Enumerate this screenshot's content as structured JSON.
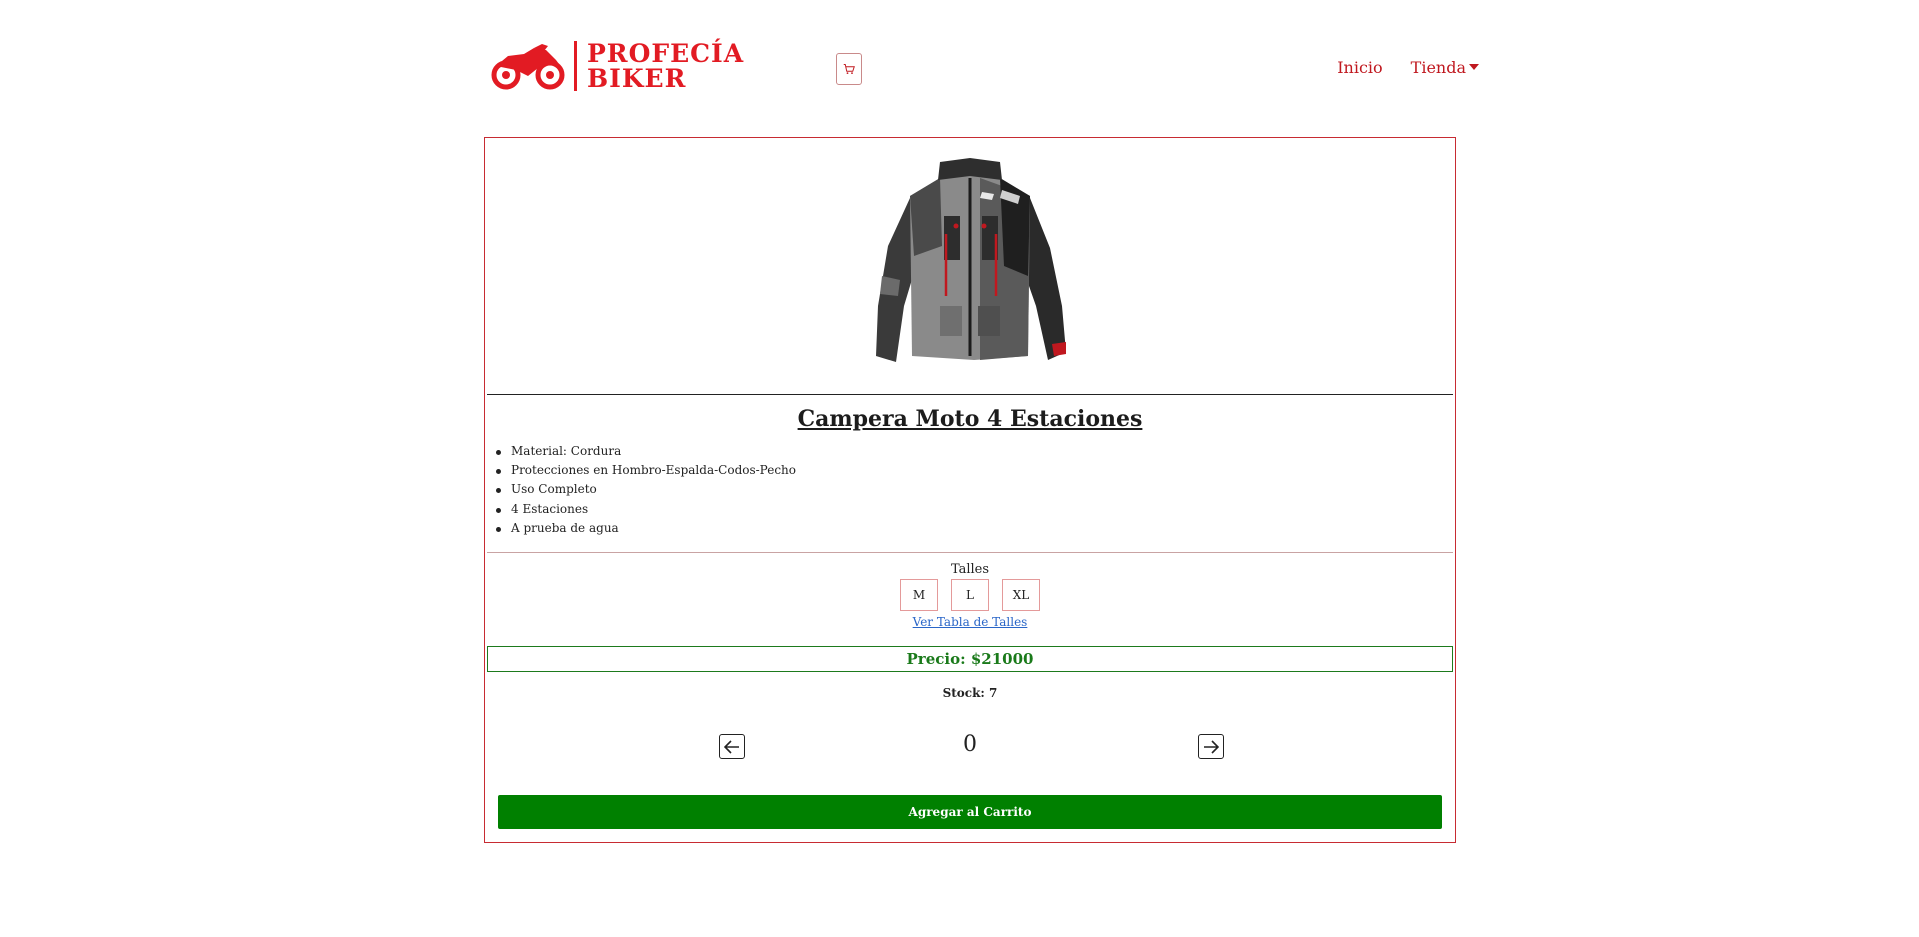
{
  "brand": {
    "line1": "PROFECÍA",
    "line2": "BIKER",
    "accent_color": "#e21b23"
  },
  "header": {
    "cart_icon": "cart-icon"
  },
  "nav": {
    "items": [
      {
        "label": "Inicio"
      },
      {
        "label": "Tienda"
      }
    ]
  },
  "product": {
    "image_icon": "jacket-image",
    "title": "Campera Moto 4 Estaciones",
    "features": [
      "Material: Cordura",
      "Protecciones en Hombro-Espalda-Codos-Pecho",
      "Uso Completo",
      "4 Estaciones",
      "A prueba de agua"
    ],
    "sizes_label": "Talles",
    "sizes": [
      "M",
      "L",
      "XL"
    ],
    "size_table_link": "Ver Tabla de Talles",
    "price": "Precio: $21000",
    "stock": "Stock: 7",
    "quantity": "0",
    "add_to_cart": "Agregar al Carrito",
    "price_color": "#1a7a1a",
    "button_color": "#008000"
  }
}
